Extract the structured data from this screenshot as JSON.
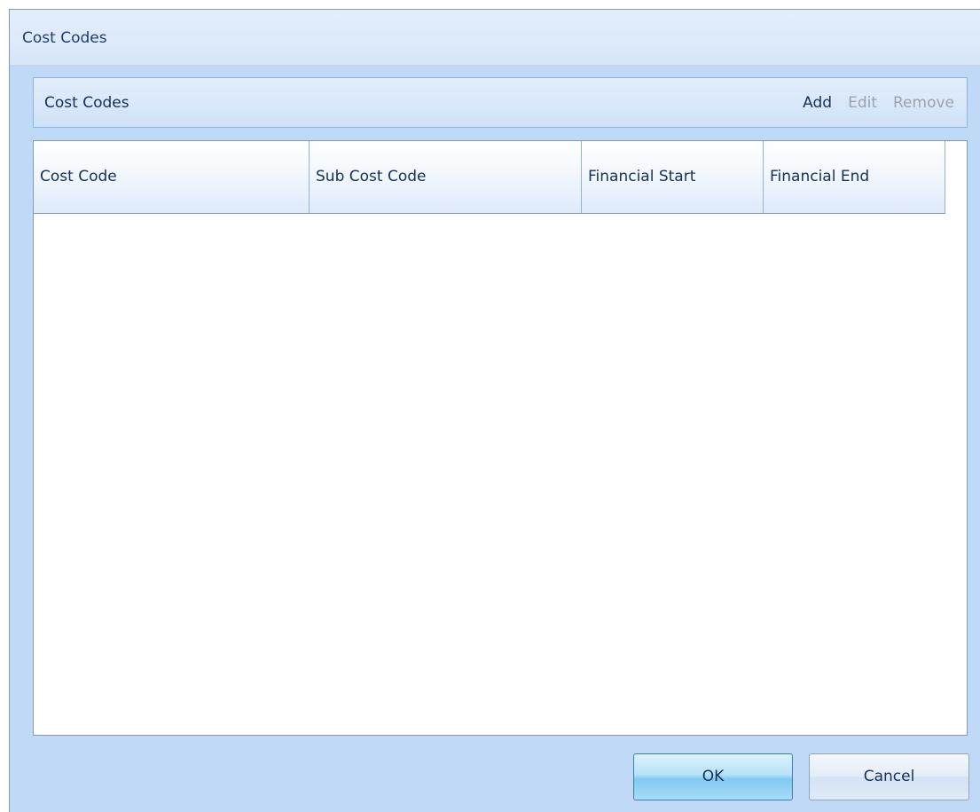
{
  "window": {
    "title": "Cost Codes"
  },
  "panel": {
    "title": "Cost Codes",
    "actions": {
      "add": "Add",
      "edit": "Edit",
      "remove": "Remove"
    }
  },
  "grid": {
    "columns": [
      "Cost Code",
      "Sub Cost Code",
      "Financial Start",
      "Financial End"
    ],
    "rows": []
  },
  "buttons": {
    "ok": "OK",
    "cancel": "Cancel"
  }
}
